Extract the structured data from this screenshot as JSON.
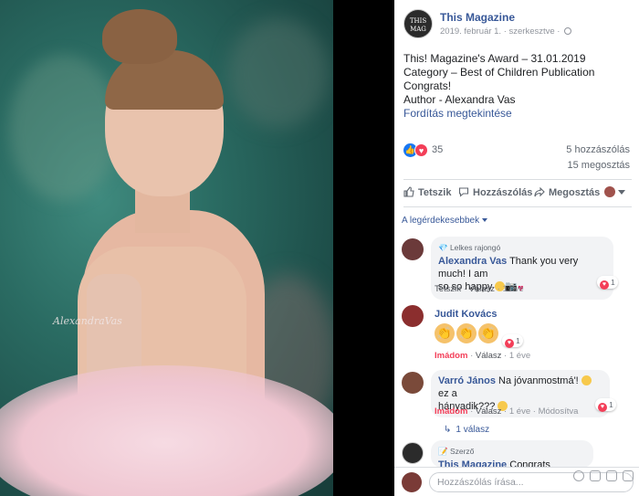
{
  "post": {
    "page_name": "This Magazine",
    "avatar_text": "THIS MAGAZINE",
    "meta": "2019. február 1. · szerkesztve ·",
    "lines": [
      "This! Magazine's Award – 31.01.2019",
      "Category – Best of Children Publication",
      "Congrats!",
      "Author - Alexandra Vas"
    ],
    "translate": "Fordítás megtekintése",
    "reaction_count": "35",
    "comments_count": "5 hozzászólás",
    "shares_count": "15 megosztás"
  },
  "photo": {
    "signature": "AlexandraVas"
  },
  "actions": {
    "like": "Tetszik",
    "comment": "Hozzászólás",
    "share": "Megosztás"
  },
  "sort_label": "A legérdekesebbek",
  "comments": [
    {
      "badge": "Lelkes rajongó",
      "name": "Alexandra Vas",
      "text_line1": "Thank you very much! I am",
      "text_line2": "so so happy",
      "like": "Tetszik",
      "reply": "Válasz",
      "time": "1 éve",
      "react_count": "1"
    },
    {
      "name": "Judit Kovács",
      "reaction_state": "Imádom",
      "reply": "Válasz",
      "time": "1 éve",
      "react_count": "1"
    },
    {
      "name": "Varró János",
      "text_a": "Na jóvanmostmá'!",
      "text_b": "ez a",
      "text_line2": "hányadik???",
      "reaction_state": "Imádom",
      "reply": "Válasz",
      "time": "1 éve",
      "edited": "Módosítva",
      "react_count": "1",
      "reply_link": "1 válasz"
    },
    {
      "badge": "Szerző",
      "name": "This Magazine",
      "text": "Congrats Alexandra!"
    }
  ],
  "composer": {
    "placeholder": "Hozzászólás írása..."
  }
}
